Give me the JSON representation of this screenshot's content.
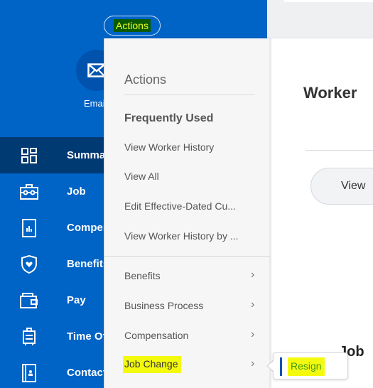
{
  "header": {
    "actions_button": "Actions"
  },
  "profile": {
    "email_label": "Email"
  },
  "sidebar": {
    "items": [
      {
        "label": "Summary",
        "icon": "dashboard-icon",
        "active": true
      },
      {
        "label": "Job",
        "icon": "briefcase-icon",
        "active": false
      },
      {
        "label": "Compensation",
        "icon": "chart-document-icon",
        "active": false
      },
      {
        "label": "Benefits",
        "icon": "shield-heart-icon",
        "active": false
      },
      {
        "label": "Pay",
        "icon": "wallet-icon",
        "active": false
      },
      {
        "label": "Time Off",
        "icon": "suitcase-icon",
        "active": false
      },
      {
        "label": "Contact",
        "icon": "contact-book-icon",
        "active": false
      }
    ]
  },
  "main": {
    "title": "Worker",
    "view_button": "View",
    "section_heading": "Job"
  },
  "menu": {
    "title": "Actions",
    "frequently_used_heading": "Frequently Used",
    "frequently_used": [
      "View Worker History",
      "View All",
      "Edit Effective-Dated Cu...",
      "View Worker History by ..."
    ],
    "categories": [
      {
        "label": "Benefits",
        "highlighted": false
      },
      {
        "label": "Business Process",
        "highlighted": false
      },
      {
        "label": "Compensation",
        "highlighted": false
      },
      {
        "label": "Job Change",
        "highlighted": true
      }
    ]
  },
  "submenu": {
    "items": [
      "Resign"
    ]
  },
  "colors": {
    "sidebar_blue": "#0063c6",
    "sidebar_active": "#003a73",
    "highlight_yellow": "#f4fa0f",
    "resign_green": "#3e9b14"
  }
}
